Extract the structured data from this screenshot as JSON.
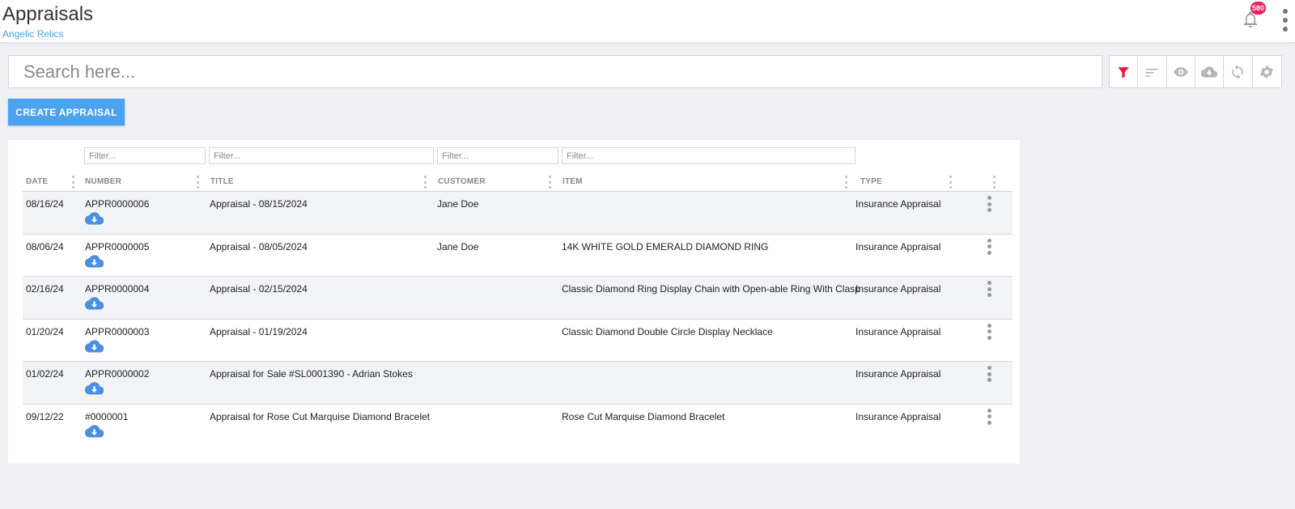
{
  "header": {
    "title": "Appraisals",
    "subtitle": "Angelic Relics",
    "notification_count": "580"
  },
  "search": {
    "placeholder": "Search here..."
  },
  "toolbar": {
    "buttons": [
      "filter-icon",
      "sort-icon",
      "eye-icon",
      "cloud-download-icon",
      "refresh-icon",
      "gear-icon"
    ],
    "active_color": "#e8173c",
    "inactive_color": "#b5b5b5"
  },
  "actions": {
    "create_label": "CREATE APPRAISAL",
    "accent": "#4aa3f0"
  },
  "table": {
    "filter_placeholder": "Filter...",
    "columns": [
      "DATE",
      "NUMBER",
      "TITLE",
      "CUSTOMER",
      "ITEM",
      "TYPE"
    ],
    "rows": [
      {
        "date": "08/16/24",
        "number": "APPR0000006",
        "title": "Appraisal - 08/15/2024",
        "customer": "Jane Doe",
        "item": "",
        "type": "Insurance Appraisal"
      },
      {
        "date": "08/06/24",
        "number": "APPR0000005",
        "title": "Appraisal - 08/05/2024",
        "customer": "Jane Doe",
        "item": "14K WHITE GOLD EMERALD DIAMOND RING",
        "type": "Insurance Appraisal"
      },
      {
        "date": "02/16/24",
        "number": "APPR0000004",
        "title": "Appraisal - 02/15/2024",
        "customer": "",
        "item": "Classic Diamond Ring Display Chain with Open-able Ring With Clasp",
        "type": "Insurance Appraisal"
      },
      {
        "date": "01/20/24",
        "number": "APPR0000003",
        "title": "Appraisal - 01/19/2024",
        "customer": "",
        "item": "Classic Diamond Double Circle Display Necklace",
        "type": "Insurance Appraisal"
      },
      {
        "date": "01/02/24",
        "number": "APPR0000002",
        "title": "Appraisal for Sale #SL0001390 - Adrian Stokes",
        "customer": "",
        "item": "",
        "type": "Insurance Appraisal"
      },
      {
        "date": "09/12/22",
        "number": "#0000001",
        "title": "Appraisal for Rose Cut Marquise Diamond Bracelet",
        "customer": "",
        "item": "Rose Cut Marquise Diamond Bracelet",
        "type": "Insurance Appraisal"
      }
    ]
  }
}
